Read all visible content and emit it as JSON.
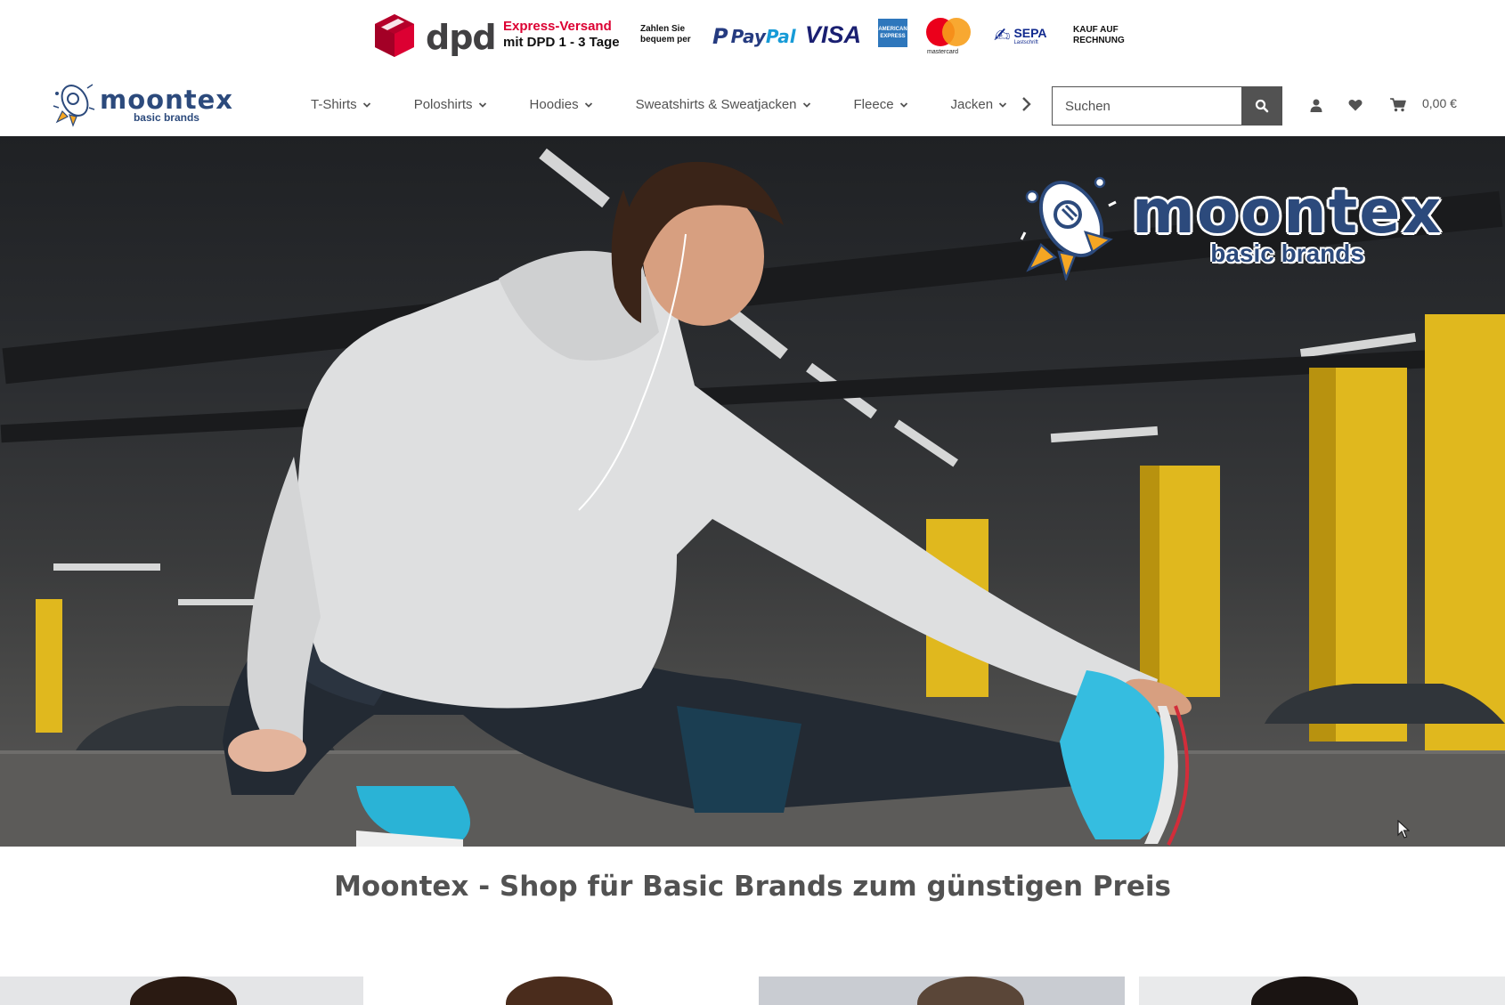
{
  "topbar": {
    "shipping_brand": "dpd",
    "express_line1": "Express-Versand",
    "express_line2": "mit DPD 1 - 3 Tage",
    "pay_line1": "Zahlen Sie",
    "pay_line2": "bequem per",
    "paypal_pay": "Pay",
    "paypal_pal": "Pal",
    "visa": "VISA",
    "amex_line1": "AMERICAN",
    "amex_line2": "EXPRESS",
    "mastercard": "mastercard",
    "sepa": "SEPA",
    "sepa_sub": "Lastschrift",
    "invoice_line1": "KAUF AUF",
    "invoice_line2": "RECHNUNG"
  },
  "logo": {
    "name": "moontex",
    "tagline": "basic brands"
  },
  "nav": {
    "items": [
      {
        "label": "T-Shirts"
      },
      {
        "label": "Poloshirts"
      },
      {
        "label": "Hoodies"
      },
      {
        "label": "Sweatshirts & Sweatjacken"
      },
      {
        "label": "Fleece"
      },
      {
        "label": "Jacken"
      }
    ]
  },
  "search": {
    "placeholder": "Suchen"
  },
  "cart": {
    "total": "0,00 €"
  },
  "hero": {
    "brand": "moontex",
    "tagline": "basic brands"
  },
  "headline": "Moontex - Shop für Basic Brands zum günstigen Preis",
  "colors": {
    "brand_blue": "#2c4a7c",
    "text_gray": "#525252",
    "dpd_red": "#dc0032",
    "rocket_orange": "#f5a623"
  }
}
